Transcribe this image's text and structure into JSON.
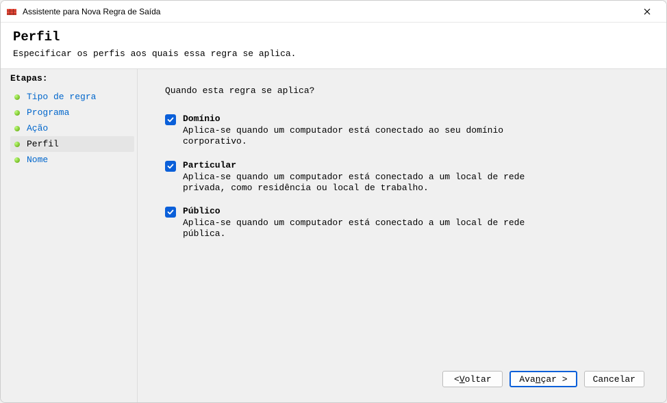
{
  "titlebar": {
    "title": "Assistente para Nova Regra de Saída"
  },
  "header": {
    "title": "Perfil",
    "subtitle": "Especificar os perfis aos quais essa regra se aplica."
  },
  "sidebar": {
    "label": "Etapas:",
    "steps": [
      {
        "label": "Tipo de regra",
        "active": false
      },
      {
        "label": "Programa",
        "active": false
      },
      {
        "label": "Ação",
        "active": false
      },
      {
        "label": "Perfil",
        "active": true
      },
      {
        "label": "Nome",
        "active": false
      }
    ]
  },
  "main": {
    "question": "Quando esta regra se aplica?",
    "options": [
      {
        "label": "Domínio",
        "desc": "Aplica-se quando um computador está conectado ao seu domínio corporativo.",
        "checked": true
      },
      {
        "label": "Particular",
        "desc": "Aplica-se quando um computador está conectado a um local de rede privada, como residência ou local de trabalho.",
        "checked": true
      },
      {
        "label": "Público",
        "desc": "Aplica-se quando um computador está conectado a um local de rede pública.",
        "checked": true
      }
    ]
  },
  "footer": {
    "back_pre": "< ",
    "back_accel": "V",
    "back_post": "oltar",
    "next_pre": "Ava",
    "next_accel": "n",
    "next_post": "çar >",
    "cancel": "Cancelar"
  }
}
